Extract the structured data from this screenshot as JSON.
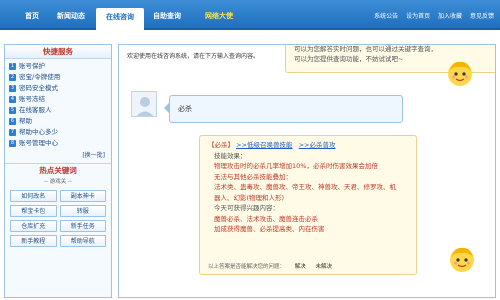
{
  "nav": {
    "tabs": [
      "首页",
      "新闻动态",
      "在线咨询",
      "自助查询",
      "网络大使"
    ],
    "links": [
      "系统公告",
      "设为首页",
      "加入收藏",
      "意见反馈"
    ]
  },
  "left": {
    "title": "快捷服务",
    "menu": [
      "账号保护",
      "密宝/令牌使用",
      "密码安全模式",
      "账号冻结",
      "在线客服人",
      "帮助",
      "帮助中心多少",
      "账号管理中心"
    ],
    "more": "[换一批]",
    "hot_title": "热点关键词",
    "hot_sub": "-- 游戏关 --",
    "hot_items": [
      "如何改名",
      "副本神卡",
      "帮宝卡包",
      "转服",
      "仓库扩充",
      "新手任务",
      "新手教程",
      "帮助导航"
    ]
  },
  "chat": {
    "welcome": "欢迎使用在线咨询系统，请在下方输入查询内容。",
    "bot1": [
      "可以为您解答实时问题，也可以通过关键字查询，",
      "可以为您提供查询功能，不妨试试吧~"
    ],
    "user_msg": "必杀",
    "bot2": {
      "head_tag": "【必杀】",
      "head_link1": ">>低级召唤兽技能",
      "head_link2": ">>必杀普攻",
      "lines": [
        "技能效果：",
        "物理攻击时的必杀几率增加10%，必杀时伤害效果会加倍",
        "无法与其他必杀技能叠加：",
        "法术类、蛊毒攻、魔兽攻、帝王攻、神兽攻、天君、修罗攻、机",
        "器人、幻影(物理和人形)",
        "今天可获得兴趣内容：",
        "魔兽必杀、法术攻击、魔兽连击必杀",
        "加成获得魔兽、必杀提高类、内在伤害"
      ],
      "footer_text": "以上答案是否能解决您的问题：",
      "solved": "解决",
      "unsolved": "未解决"
    }
  },
  "colors": {
    "nav_bg": "#1f6fc0",
    "accent_red": "#c0392b",
    "link_blue": "#1f5fbf",
    "bubble_yellow": "#fffbe6",
    "bubble_blue": "#eef6ff"
  }
}
